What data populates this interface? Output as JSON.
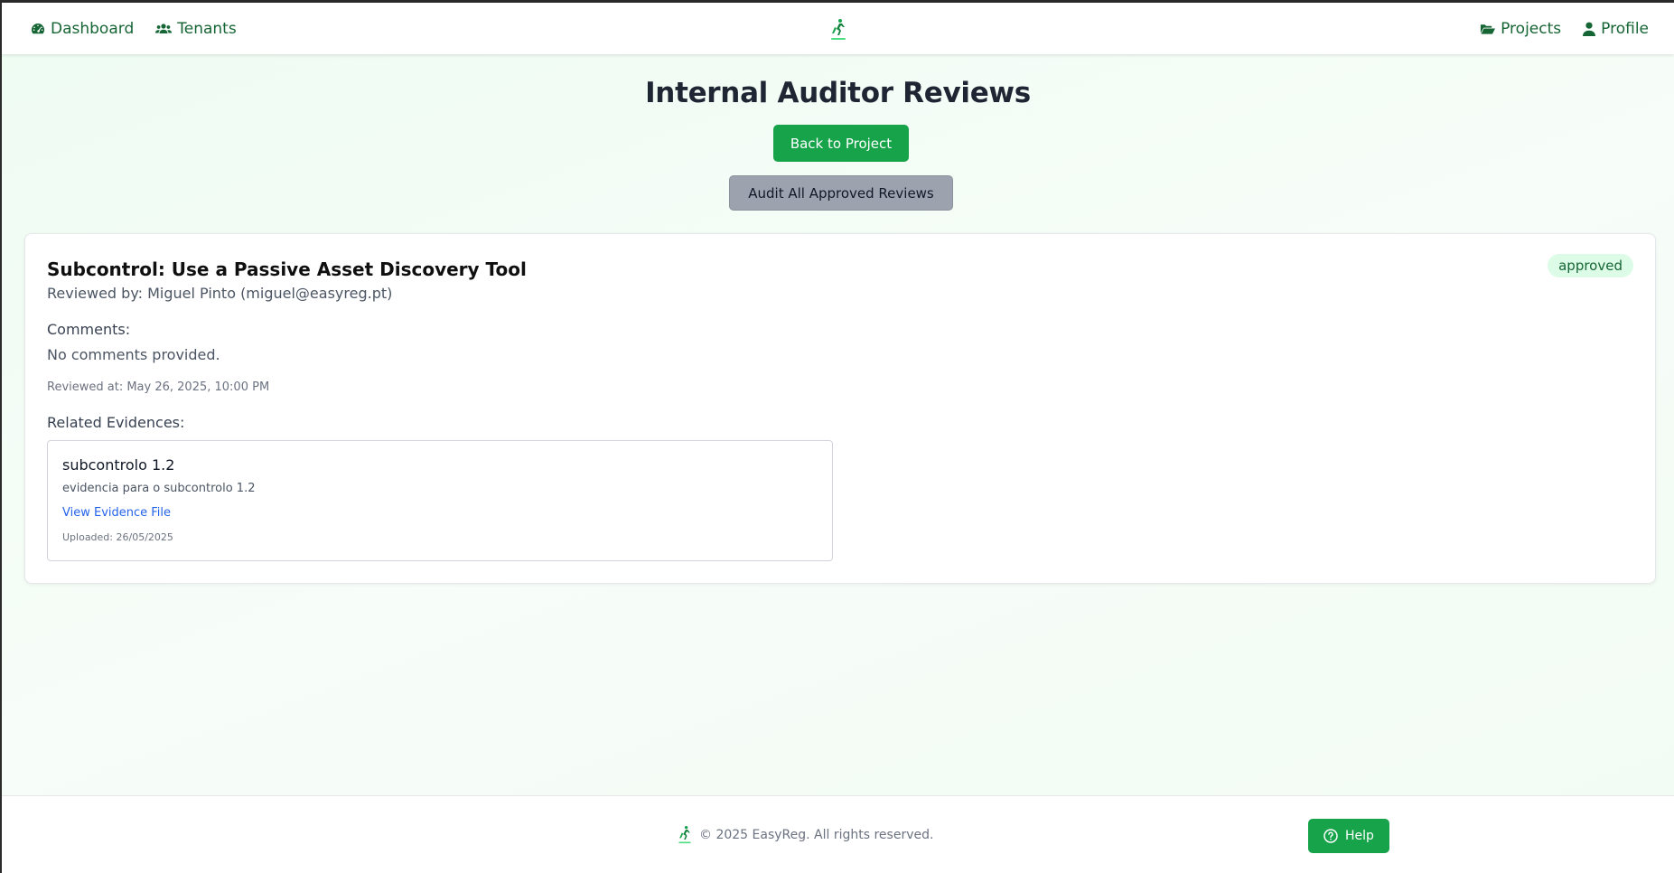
{
  "nav": {
    "left": [
      {
        "label": "Dashboard",
        "icon": "dashboard-icon"
      },
      {
        "label": "Tenants",
        "icon": "users-icon"
      }
    ],
    "right": [
      {
        "label": "Projects",
        "icon": "folder-open-icon"
      },
      {
        "label": "Profile",
        "icon": "user-icon"
      }
    ],
    "logo_icon": "easyreg-logo"
  },
  "page": {
    "title": "Internal Auditor Reviews",
    "back_button": "Back to Project",
    "audit_button": "Audit All Approved Reviews"
  },
  "review": {
    "title": "Subcontrol: Use a Passive Asset Discovery Tool",
    "reviewer": "Reviewed by: Miguel Pinto (miguel@easyreg.pt)",
    "status": "approved",
    "comments_label": "Comments:",
    "comments": "No comments provided.",
    "reviewed_at": "Reviewed at: May 26, 2025, 10:00 PM",
    "related_label": "Related Evidences:",
    "evidences": [
      {
        "title": "subcontrolo 1.2",
        "description": "evidencia para o subcontrolo 1.2",
        "link": "View Evidence File",
        "uploaded": "Uploaded: 26/05/2025"
      }
    ]
  },
  "footer": {
    "copyright": "© 2025 EasyReg. All rights reserved.",
    "help_button": "Help"
  },
  "colors": {
    "brand_green": "#16a34a",
    "nav_text": "#166534",
    "badge_bg": "#dcfce7",
    "audit_button_bg": "#9ca3af",
    "link_blue": "#2563eb"
  }
}
